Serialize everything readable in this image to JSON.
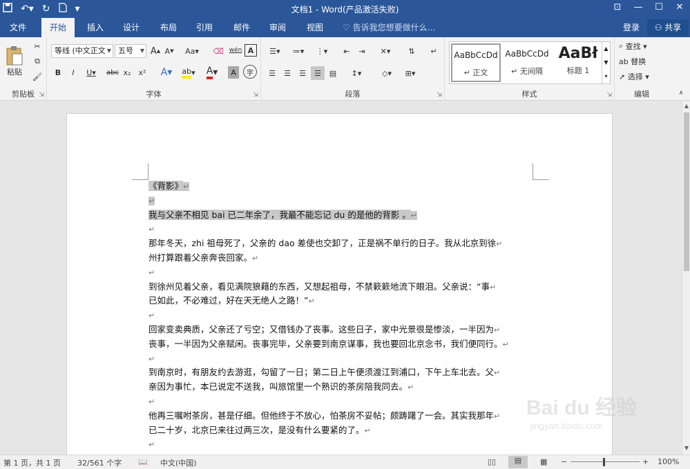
{
  "window": {
    "title": "文档1 - Word(产品激活失败)",
    "qat_icons": [
      "save-icon",
      "undo-icon",
      "redo-icon",
      "new-doc-icon",
      "customize-icon"
    ]
  },
  "tabs": {
    "items": [
      "文件",
      "开始",
      "插入",
      "设计",
      "布局",
      "引用",
      "邮件",
      "审阅",
      "视图"
    ],
    "active": "开始",
    "tell_me": "告诉我您想要做什么...",
    "login": "登录",
    "share": "共享"
  },
  "ribbon": {
    "clipboard": {
      "paste": "粘贴",
      "label": "剪贴板"
    },
    "font": {
      "name": "等线 (中文正文",
      "size": "五号",
      "change_case": "Aa",
      "phonetic": "wén",
      "label": "字体",
      "bold": "B",
      "italic": "I",
      "underline": "U",
      "strike": "abc",
      "sub": "x₂",
      "sup": "x²",
      "effects": "A",
      "color_a": "A",
      "shade_a": "A",
      "enclose": "字"
    },
    "paragraph": {
      "label": "段落"
    },
    "styles": {
      "label": "样式",
      "items": [
        {
          "preview": "AaBbCcDd",
          "name": "↵ 正文"
        },
        {
          "preview": "AaBbCcDd",
          "name": "↵ 无间隔"
        },
        {
          "preview": "AaBł",
          "name": "标题 1"
        }
      ]
    },
    "editing": {
      "find": "查找",
      "replace": "替换",
      "select": "选择",
      "label": "编辑"
    }
  },
  "document": {
    "paragraphs": [
      {
        "text": "《背影》",
        "highlight": true
      },
      {
        "text": "",
        "highlight": true
      },
      {
        "text": "我与父亲不相见 bai 已二年余了，我最不能忘记 du 的是他的背影 。",
        "highlight": true
      },
      {
        "text": "",
        "highlight": false
      },
      {
        "text": "那年冬天，zhi 祖母死了，父亲的 dao 差使也交卸了，正是祸不单行的日子。我从北京到徐",
        "highlight": false
      },
      {
        "text": "州打算跟着父亲奔丧回家。",
        "highlight": false
      },
      {
        "text": "",
        "highlight": false
      },
      {
        "text": "到徐州见着父亲，看见满院狼藉的东西，又想起祖母，不禁簌簌地流下眼泪。父亲说：“事",
        "highlight": false
      },
      {
        "text": "已如此，不必难过，好在天无绝人之路！”",
        "highlight": false
      },
      {
        "text": "",
        "highlight": false
      },
      {
        "text": "回家变卖典质，父亲还了亏空；又借钱办了丧事。这些日子，家中光景很是惨淡，一半因为",
        "highlight": false
      },
      {
        "text": "丧事，一半因为父亲赋闲。丧事完毕，父亲要到南京谋事，我也要回北京念书，我们便同行。",
        "highlight": false
      },
      {
        "text": "",
        "highlight": false
      },
      {
        "text": "到南京时，有朋友约去游逛，勾留了一日；第二日上午便须渡江到浦口，下午上车北去。父",
        "highlight": false
      },
      {
        "text": "亲因为事忙，本已说定不送我，叫旅馆里一个熟识的茶房陪我同去。",
        "highlight": false
      },
      {
        "text": "",
        "highlight": false
      },
      {
        "text": "他再三嘱咐茶房，甚是仔细。但他终于不放心，怕茶房不妥帖；颇踌躇了一会。其实我那年",
        "highlight": false
      },
      {
        "text": "已二十岁，北京已来往过两三次，是没有什么要紧的了。",
        "highlight": false
      },
      {
        "text": "",
        "highlight": false
      }
    ],
    "para_mark": "↵"
  },
  "status": {
    "page": "第 1 页，共 1 页",
    "words": "32/561 个字",
    "language": "中文(中国)",
    "zoom": "100%",
    "zoom_minus": "−",
    "zoom_plus": "+"
  },
  "watermark": {
    "brand": "Bai du 经验",
    "url": "jingyan.baidu.com"
  }
}
